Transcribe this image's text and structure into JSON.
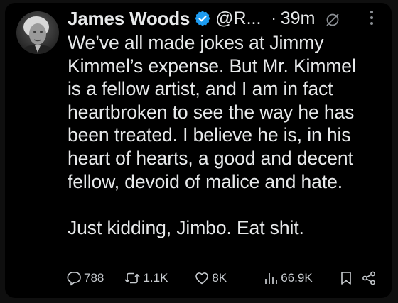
{
  "tweet": {
    "author_name": "James Woods",
    "handle": "@R...",
    "separator": "·",
    "time": "39m",
    "paragraphs": [
      "We’ve all made jokes at Jimmy Kimmel’s expense. But Mr. Kimmel is a fellow artist, and I am in fact heartbroken to see the way he has been treated. I believe he is, in his heart of hearts, a good and decent fellow, devoid of malice and hate.",
      "Just kidding, Jimbo. Eat shit."
    ],
    "lines": [
      "We’ve all made jokes at Jimmy",
      "Kimmel’s expense. But Mr. Kimmel",
      "is a fellow artist, and I am in fact",
      "heartbroken to see the way he has",
      "been treated. I believe he is, in his",
      "heart of hearts, a good and decent",
      "fellow, devoid of malice and hate."
    ],
    "line_last": "Just kidding, Jimbo. Eat shit."
  },
  "actions": {
    "replies": "788",
    "reposts": "1.1K",
    "likes": "8K",
    "views": "66.9K"
  },
  "icons": {
    "verified": "verified-badge-icon",
    "muted": "mute-icon",
    "more": "more-options-icon",
    "reply": "reply-icon",
    "repost": "repost-icon",
    "like": "heart-icon",
    "views": "views-icon",
    "bookmark": "bookmark-icon",
    "share": "share-icon"
  },
  "colors": {
    "background": "#000000",
    "text": "#e7e9ea",
    "verified_blue": "#1d9bf0",
    "secondary": "#c8ccd0"
  }
}
